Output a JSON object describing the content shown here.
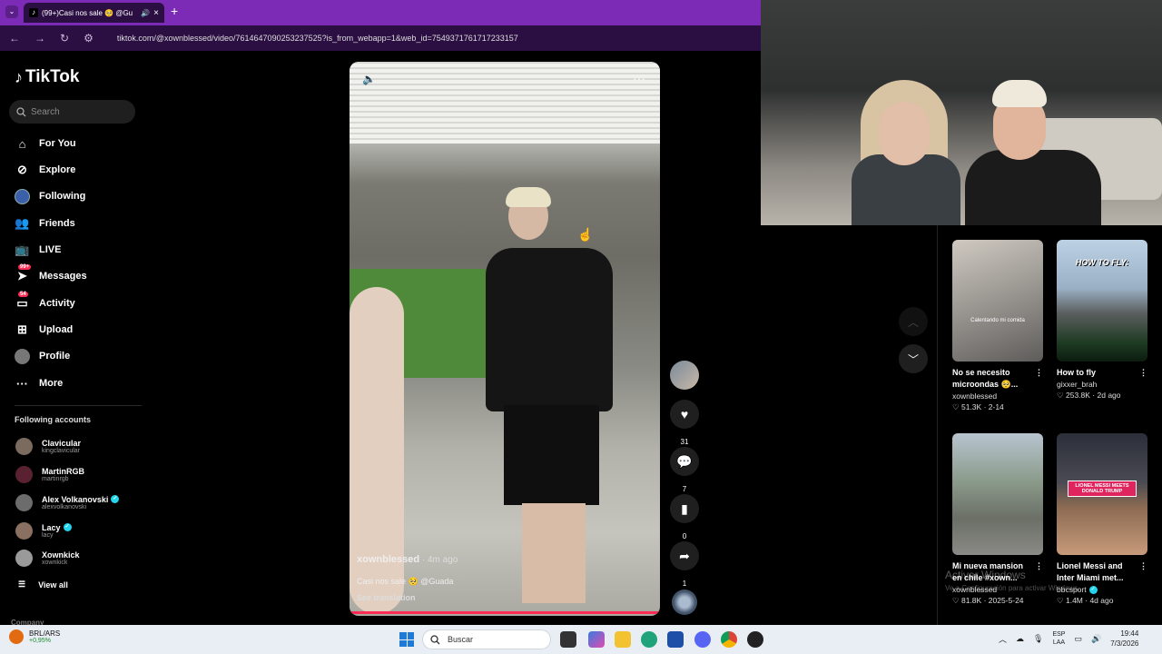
{
  "browser": {
    "tab_title": "(99+)Casi nos sale 🥺 @Gu",
    "url": "tiktok.com/@xownblessed/video/7614647090253237525?is_from_webapp=1&web_id=7549371761717233157"
  },
  "sidebar": {
    "logo": "TikTok",
    "search_placeholder": "Search",
    "nav": [
      {
        "label": "For You",
        "icon": "home-icon"
      },
      {
        "label": "Explore",
        "icon": "compass-icon"
      },
      {
        "label": "Following",
        "icon": "following-avatar-icon"
      },
      {
        "label": "Friends",
        "icon": "friends-icon"
      },
      {
        "label": "LIVE",
        "icon": "live-icon"
      },
      {
        "label": "Messages",
        "icon": "messages-icon",
        "badge": "99+"
      },
      {
        "label": "Activity",
        "icon": "activity-icon",
        "badge": "54"
      },
      {
        "label": "Upload",
        "icon": "upload-icon"
      },
      {
        "label": "Profile",
        "icon": "profile-avatar-icon"
      },
      {
        "label": "More",
        "icon": "more-dots-icon"
      }
    ],
    "following_heading": "Following accounts",
    "accounts": [
      {
        "name": "Clavicular",
        "handle": "kingclavicular",
        "verified": false
      },
      {
        "name": "MartinRGB",
        "handle": "martinrgb",
        "verified": false
      },
      {
        "name": "Alex Volkanovski",
        "handle": "alexvolkanovski",
        "verified": true
      },
      {
        "name": "Lacy",
        "handle": "lacy",
        "verified": true
      },
      {
        "name": "Xownkick",
        "handle": "xownkick",
        "verified": false
      }
    ],
    "view_all": "View all",
    "company": "Company"
  },
  "video": {
    "author": "xownblessed",
    "ago": " · 4m ago",
    "caption": "Casi nos sale 🥺 @Guada",
    "see_translation": "See translation",
    "likes": "31",
    "comments": "7",
    "saves": "0",
    "shares": "1"
  },
  "recommended": [
    {
      "caption": "No se necesito microondas 🥺...",
      "author": "xownblessed",
      "likes": "51.3K",
      "date": "2-14",
      "overlay": "Calentando mi comida",
      "verified": false
    },
    {
      "caption": "How to fly",
      "author": "gixxer_brah",
      "likes": "253.8K",
      "date": "2d ago",
      "overlay": "HOW TO FLY:",
      "verified": false
    },
    {
      "caption": "Mi nueva mansion en chile #xown...",
      "author": "xownblessed",
      "likes": "81.8K",
      "date": "2025-5-24",
      "overlay": "",
      "verified": false
    },
    {
      "caption": "Lionel Messi and Inter Miami met...",
      "author": "bbcsport",
      "likes": "1.4M",
      "date": "4d ago",
      "overlay": "LIONEL MESSI MEETS DONALD TRUMP",
      "verified": true
    }
  ],
  "watermark": {
    "title": "Activar Windows",
    "subtitle": "Ve a Configuración para activar Windows."
  },
  "taskbar": {
    "stock_name": "BRL/ARS",
    "stock_change": "+0,95%",
    "search_placeholder": "Buscar",
    "lang_top": "ESP",
    "lang_bottom": "LAA",
    "time": "19:44",
    "date": "7/3/2026"
  },
  "colors": {
    "accent": "#fe2c55",
    "verified": "#20d5ec",
    "browser_tabbar": "#7b2bb5"
  }
}
